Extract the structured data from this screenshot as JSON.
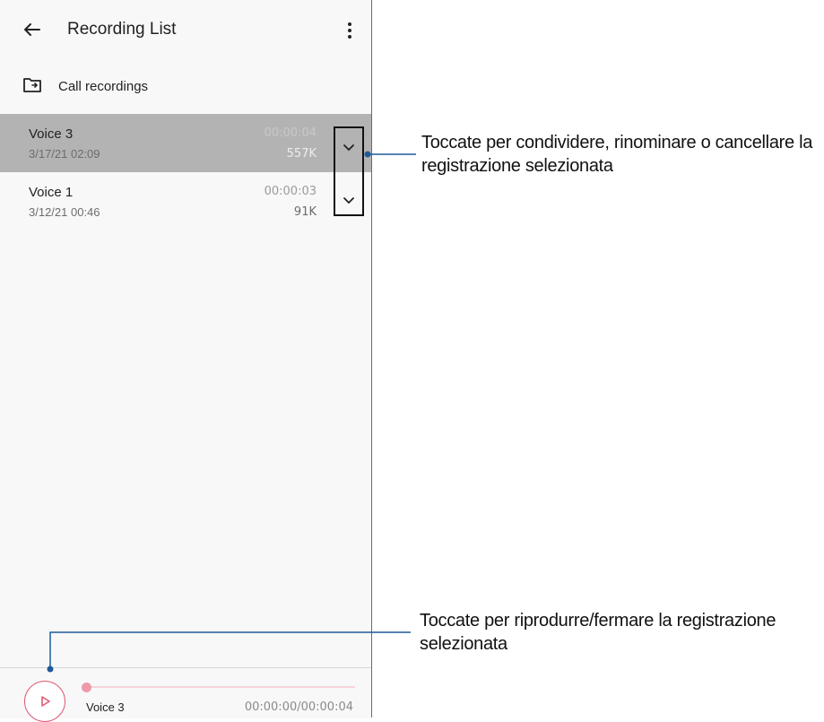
{
  "app": {
    "title": "Recording List",
    "back_icon": "arrow-left-icon",
    "more_icon": "more-vertical-icon"
  },
  "folder": {
    "icon": "folder-icon",
    "label": "Call recordings"
  },
  "recordings": [
    {
      "name": "Voice 3",
      "date": "3/17/21 02:09",
      "duration": "00:00:04",
      "size": "557K",
      "selected": true
    },
    {
      "name": "Voice 1",
      "date": "3/12/21 00:46",
      "duration": "00:00:03",
      "size": "91K",
      "selected": false
    }
  ],
  "player": {
    "name": "Voice 3",
    "time": "00:00:00/00:00:04",
    "progress": 0,
    "accent": "#e05a75"
  },
  "callouts": {
    "menu_line1": "Toccate per condividere, rinominare o cancellare la",
    "menu_line2": "registrazione selezionata",
    "play_line1": "Toccate per riprodurre/fermare la registrazione",
    "play_line2": "selezionata",
    "line_color": "#1f5a9a"
  },
  "colors": {
    "selected_row": "#b3b3b3",
    "background": "#f8f8f8"
  }
}
